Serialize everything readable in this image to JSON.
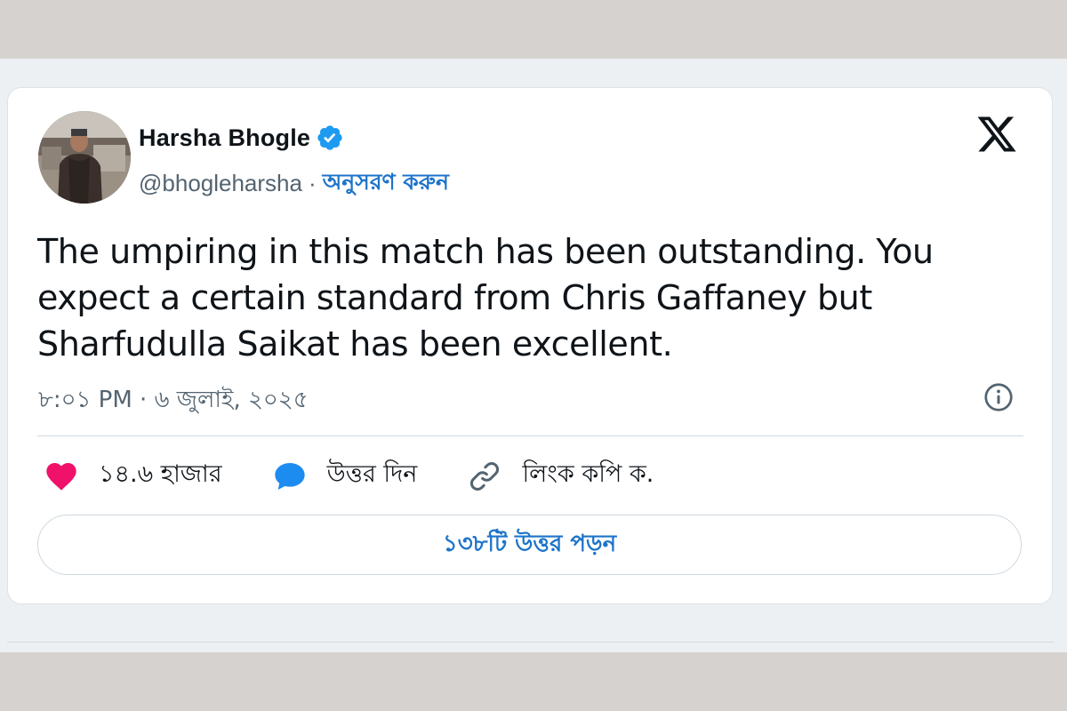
{
  "colors": {
    "accent": "#1d74c9",
    "like": "#f0116a",
    "reply": "#1d8cf0",
    "text": "#0f1419",
    "muted": "#536471"
  },
  "author": {
    "name": "Harsha Bhogle",
    "handle": "@bhogleharsha",
    "separator": "·",
    "follow_label": "অনুসরণ করুন",
    "verified_icon": "verified-badge-icon",
    "avatar_icon": "profile-photo"
  },
  "platform_icon": "x-logo-icon",
  "tweet": {
    "text": "The umpiring in this match has been outstanding. You expect a certain standard from Chris Gaffaney but Sharfudulla Saikat has been excellent.",
    "timestamp": "৮:০১ PM · ৬ জুলাই, ২০২৫"
  },
  "actions": {
    "likes": {
      "icon": "heart-icon",
      "label": "১৪.৬ হাজার"
    },
    "reply": {
      "icon": "speech-bubble-icon",
      "label": "উত্তর দিন"
    },
    "copy_link": {
      "icon": "link-icon",
      "label": "লিংক কপি ক."
    }
  },
  "info_icon": "info-icon",
  "read_replies_label": "১৩৮টি উত্তর পড়ন"
}
